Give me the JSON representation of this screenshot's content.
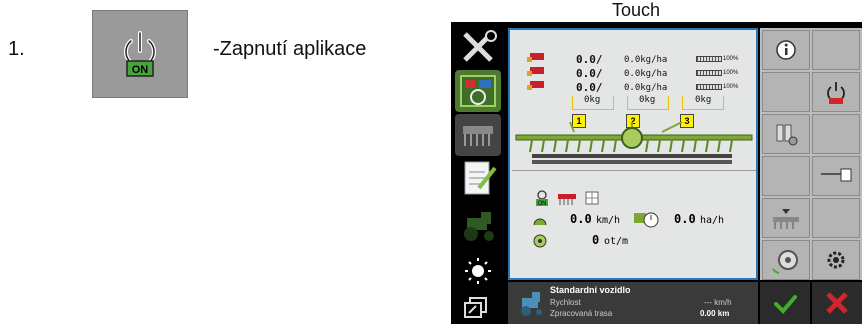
{
  "instruction": {
    "step_number": "1.",
    "button_label": "ON",
    "description": "-Zapnutí aplikace"
  },
  "touch_label": "Touch",
  "metering_rows": [
    {
      "value": "0.0/",
      "rate": "0.0kg/ha",
      "percent": "100%"
    },
    {
      "value": "0.0/",
      "rate": "0.0kg/ha",
      "percent": "100%"
    },
    {
      "value": "0.0/",
      "rate": "0.0kg/ha",
      "percent": "100%"
    }
  ],
  "hoppers": [
    {
      "kg": "0kg",
      "number": "1"
    },
    {
      "kg": "0kg",
      "number": "2"
    },
    {
      "kg": "0kg",
      "number": "3"
    }
  ],
  "mode_icons": {
    "on_label": "ON"
  },
  "speed": {
    "value": "0.0",
    "unit": "km/h"
  },
  "area_rate": {
    "value": "0.0",
    "unit": "ha/h"
  },
  "rotation": {
    "value": "0",
    "unit": "ot/m"
  },
  "status_bar": {
    "vehicle_name": "Standardní vozidlo",
    "speed_label": "Rychlost",
    "speed_value": "--- km/h",
    "distance_label": "Zpracovaná trasa",
    "distance_value": "0.00 km"
  },
  "colors": {
    "screen_border": "#2e76b3",
    "machine_green": "#7fa832",
    "hopper_outline": "#f0c000",
    "ok_green": "#3fae2a",
    "cancel_red": "#d0262b"
  }
}
